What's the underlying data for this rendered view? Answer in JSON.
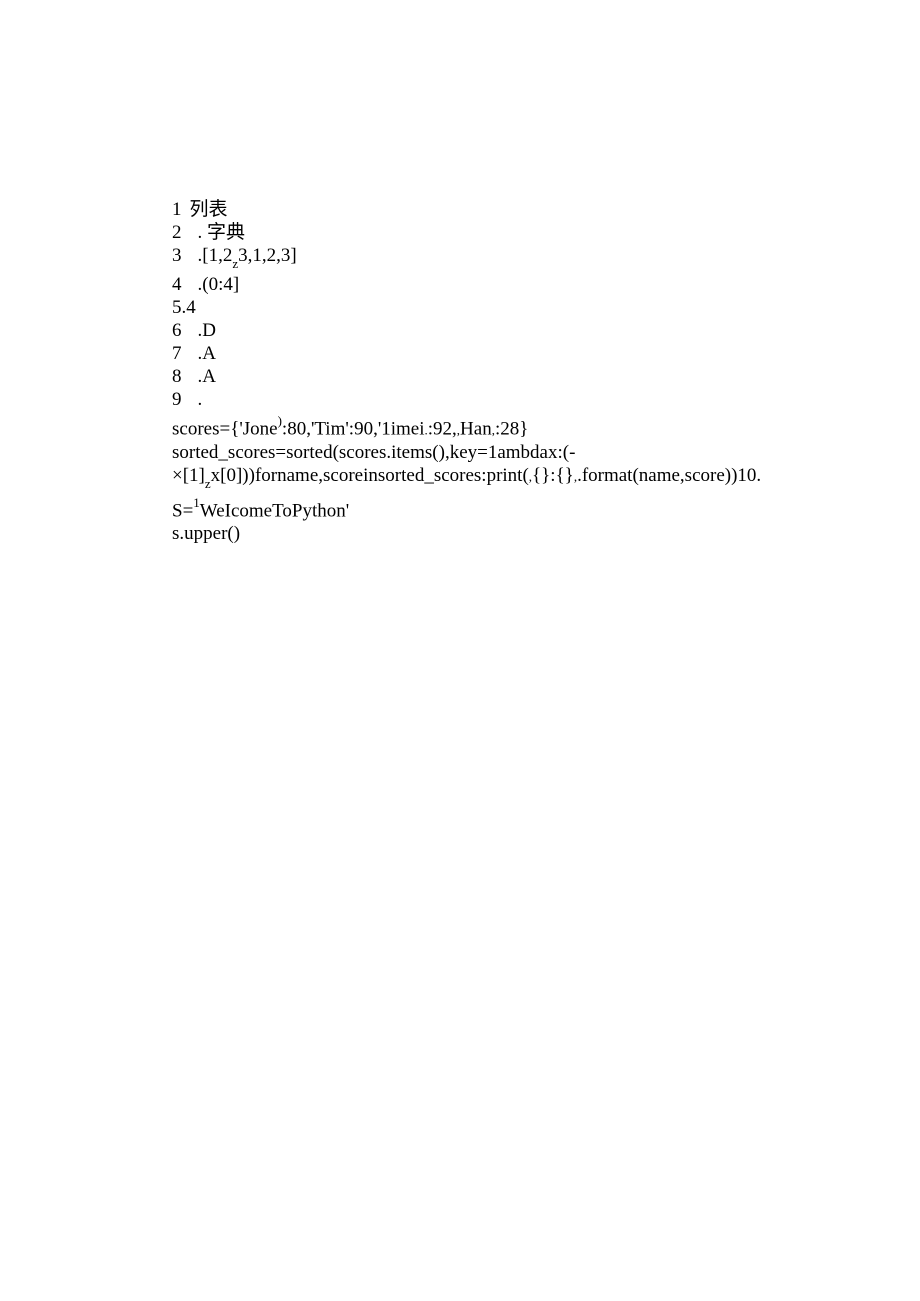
{
  "lines": {
    "l1_num": "1",
    "l1_text": "列表",
    "l2_num": "2",
    "l2_text": ". 字典",
    "l3_num": "3",
    "l3_pre": ".[1,2",
    "l3_sub": "z",
    "l3_post": "3,1,2,3]",
    "l4_num": "4",
    "l4_text": ".(0:4]",
    "l5": "5.4",
    "l6_num": "6",
    "l6_text": ".D",
    "l7_num": "7",
    "l7_text": ".A",
    "l8_num": "8",
    "l8_text": ".A",
    "l9_num": "9",
    "l9_text": ".",
    "l10_a": "scores={'Jone",
    "l10_sup": ")",
    "l10_b": ":80,'Tim':90,'1imei",
    "l10_c": ":92,",
    "l10_d": "Han",
    "l10_e": ":28}",
    "l11": "sorted_scores=sorted(scores.items(),key=1ambdax:(-",
    "l12_a": "×[1]",
    "l12_sub": "z",
    "l12_b": "x[0]))forname,scoreinsorted_scores:print(",
    "l12_c": "{}:{}",
    "l12_d": ".format(name,score))10.",
    "l13_a": "S=",
    "l13_sup": "1",
    "l13_b": "WeIcomeToPython'",
    "l14": "s.upper()"
  }
}
